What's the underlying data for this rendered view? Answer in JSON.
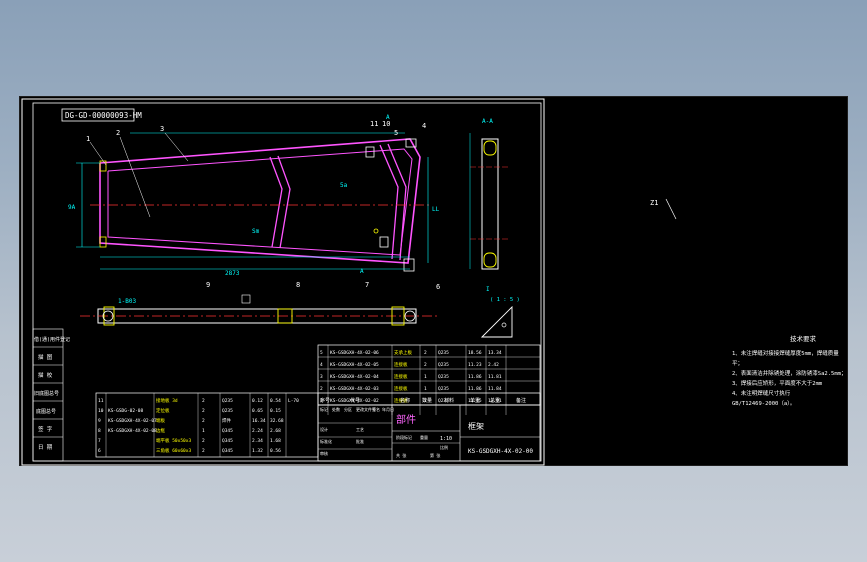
{
  "drawing": {
    "code_box": "DG-GD-00000093-HM",
    "section_label": "A-A",
    "small_label": "Z1",
    "scale_note": "( 1 : 5 )",
    "detail_label": "I",
    "dimensions": {
      "top_length": "5a",
      "mid": "Sm",
      "bottom": "2873",
      "left": "9A",
      "right": "LL",
      "bottom_right": "A",
      "side_a": "A",
      "bar_top": "1-B03"
    },
    "callouts": [
      "1",
      "2",
      "3",
      "11",
      "10",
      "5",
      "4",
      "6",
      "7",
      "8",
      "9"
    ],
    "side_table": [
      "借(通)用件登记",
      "描 图",
      "描 校",
      "旧底图总号",
      "底图总号",
      "签 字",
      "日 期"
    ]
  },
  "tech_notes": {
    "title": "技术要求",
    "lines": [
      "1、未注焊缝对接接焊缝厚度5mm，焊缝质量",
      "平；",
      "2、表面清洁并除锈处理，涂防锈漆Sa2.5mm；",
      "3、焊接后应矫形，平面度不大于2mm",
      "4、未注明焊缝尺寸执行",
      "GB/T12469-2000（a）。"
    ]
  },
  "bom_upper": {
    "rows": [
      [
        "5",
        "KS-GSDGXH-4X-02-06",
        "支承上板",
        "2",
        "Q235",
        "18.56",
        "13.34"
      ],
      [
        "4",
        "KS-GSDGXH-4X-02-05",
        "连接板",
        "2",
        "Q235",
        "11.23",
        "2.42"
      ],
      [
        "3",
        "KS-GSDGXH-4X-02-04",
        "连接板",
        "1",
        "Q235",
        "11.86",
        "11.81"
      ],
      [
        "2",
        "KS-GSDGXH-4X-02-03",
        "连接板",
        "1",
        "Q235",
        "11.86",
        "11.84"
      ],
      [
        "1",
        "KS-GSDGXH-4X-02-02",
        "连接板",
        "2",
        "Q235",
        "11.45",
        "12.91"
      ]
    ],
    "header": [
      "序号",
      "代号",
      "名称",
      "数量",
      "材料",
      "单重",
      "总重",
      "备注"
    ]
  },
  "bom_lower": {
    "rows": [
      [
        "11",
        "",
        "接地板 3d",
        "2",
        "Q235",
        "0.12",
        "0.54",
        "L-70"
      ],
      [
        "10",
        "KS-GSDG-02-08",
        "定位板",
        "2",
        "Q235",
        "0.65",
        "0.15",
        ""
      ],
      [
        "9",
        "KS-GSDGXH-4X-02-07",
        "端板",
        "2",
        "焊件",
        "16.34",
        "32.68",
        ""
      ],
      [
        "8",
        "KS-GSDGXH-4X-02-08",
        "边框",
        "1",
        "Q345",
        "2.24",
        "2.68",
        ""
      ],
      [
        "7",
        "",
        "端平板 50x50x3",
        "2",
        "Q345",
        "2.34",
        "1.68",
        ""
      ],
      [
        "6",
        "",
        "三角板 60x60x3",
        "2",
        "Q345",
        "1.32",
        "0.56",
        ""
      ]
    ]
  },
  "title_block": {
    "type": "部件",
    "name": "框架",
    "scale": "1:10",
    "code": "KS-GSDGXH-4X-02-00",
    "labels": [
      "标记",
      "处数",
      "分区",
      "更改文件号",
      "签名",
      "年月日",
      "设计",
      "标准化",
      "审核",
      "工艺",
      "批准",
      "阶段标记",
      "重量",
      "比例",
      "共 张",
      "第 张"
    ]
  }
}
